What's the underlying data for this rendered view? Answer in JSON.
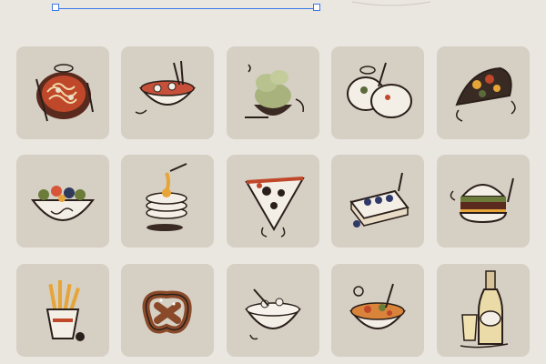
{
  "colors": {
    "background": "#eae7e1",
    "tile": "#d6cfc4",
    "selection": "#3b78e7"
  },
  "tiles": [
    {
      "icon": "pasta-bowl-icon"
    },
    {
      "icon": "noodle-bowl-chopsticks-icon"
    },
    {
      "icon": "ice-cream-icon"
    },
    {
      "icon": "dumplings-bowl-icon"
    },
    {
      "icon": "taco-icon"
    },
    {
      "icon": "salad-bowl-icon"
    },
    {
      "icon": "pancakes-honey-icon"
    },
    {
      "icon": "pizza-slice-icon"
    },
    {
      "icon": "sandwich-blueberry-icon"
    },
    {
      "icon": "burger-icon"
    },
    {
      "icon": "french-fries-icon"
    },
    {
      "icon": "pretzel-icon"
    },
    {
      "icon": "rice-bowl-icon"
    },
    {
      "icon": "soup-bowl-icon"
    },
    {
      "icon": "beer-bottle-icon"
    }
  ]
}
